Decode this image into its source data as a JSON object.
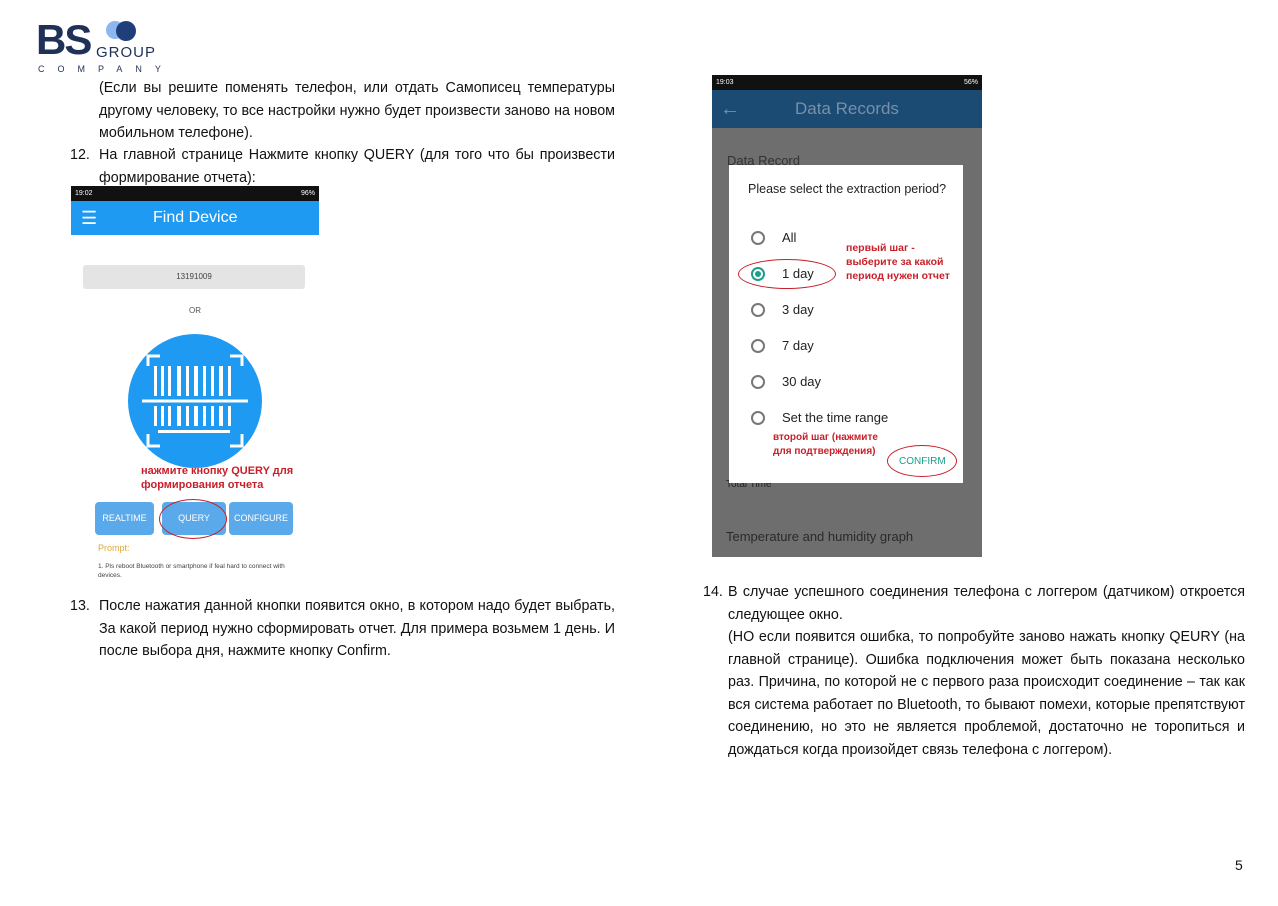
{
  "logo": {
    "main": "BS",
    "group": "GROUP",
    "company": "COMPANY",
    "colors": {
      "navy": "#1f3157",
      "light_blue": "#8cb7ef"
    }
  },
  "left": {
    "intro": "(Если вы решите поменять телефон, или отдать Самописец температуры другому человеку, то все настройки нужно будет произвести заново на новом мобильном телефоне).",
    "item12": {
      "num": "12.",
      "text": "На главной странице Нажмите кнопку QUERY (для того что бы произвести формирование отчета):"
    },
    "item13": {
      "num": "13.",
      "text": "После нажатия данной кнопки появится окно, в котором надо будет выбрать, За какой период нужно сформировать отчет. Для примера возьмем 1 день. И после выбора дня, нажмите кнопку Confirm."
    }
  },
  "phone1": {
    "time": "19:02",
    "battery": "96%",
    "title": "Find Device",
    "menu_icon": "hamburger-icon",
    "device_id": "13191009",
    "or": "OR",
    "scan_icon": "barcode-scan-icon",
    "annotation": "нажмите кнопку QUERY для формирования отчета",
    "buttons": [
      "REALTIME",
      "QUERY",
      "CONFIGURE"
    ],
    "prompt_label": "Prompt:",
    "prompt_text": "1. Pls reboot Bluetooth or smartphone if feal hard to connect with devices.",
    "accent": "#1e9af2"
  },
  "phone2": {
    "time": "19:03",
    "battery": "56%",
    "title": "Data Records",
    "back_icon": "arrow-left-icon",
    "section": "Data Record",
    "total_time": "Total Time",
    "total_value": "--",
    "graph_label": "Temperature and humidity graph",
    "dialog": {
      "title": "Please select the extraction period?",
      "options": [
        "All",
        "1 day",
        "3 day",
        "7 day",
        "30 day",
        "Set the time range"
      ],
      "selected": "1 day",
      "confirm": "CONFIRM"
    },
    "annotation1": "первый шаг - выберите за какой период нужен отчет",
    "annotation2": "второй шаг (нажмите для подтверждения)"
  },
  "right": {
    "item14": {
      "num": "14.",
      "text": "В случае успешного соединения телефона с логгером (датчиком) откроется следующее окно.",
      "note": "(НО если появится ошибка, то попробуйте заново нажать кнопку QEURY (на главной странице). Ошибка подключения может быть показана несколько раз. Причина, по которой не с первого раза происходит соединение – так как вся система работает по Bluetooth, то бывают помехи, которые препятствуют соединению, но это не является проблемой, достаточно не торопиться и дождаться когда произойдет связь телефона с логгером)."
    }
  },
  "page_number": "5"
}
